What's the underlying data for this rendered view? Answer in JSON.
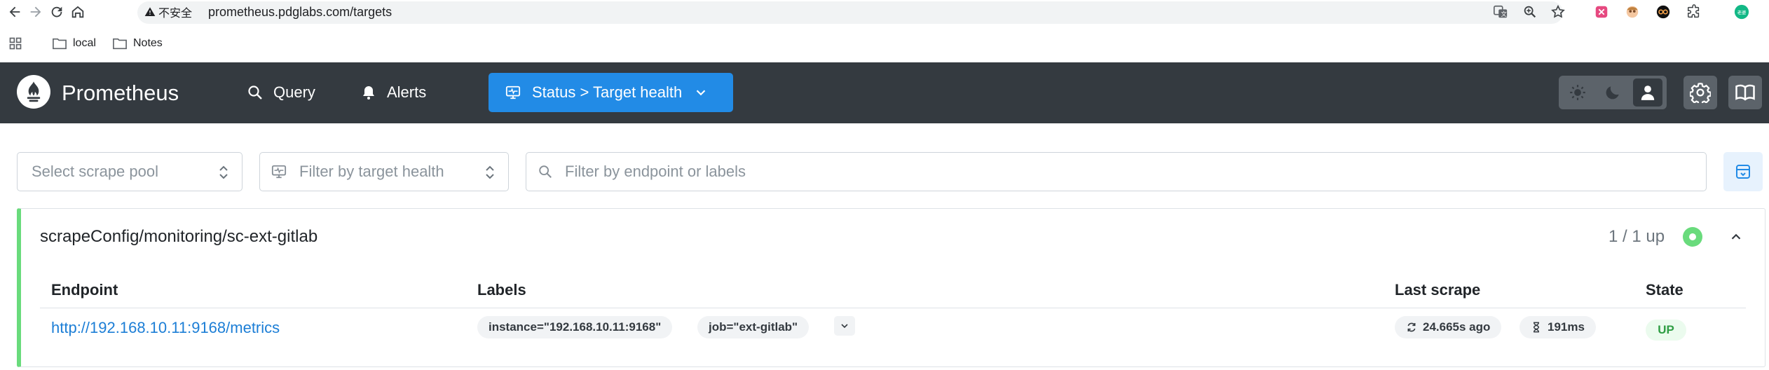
{
  "browser": {
    "security_label": "不安全",
    "url": "prometheus.pdglabs.com/targets",
    "bookmarks": [
      {
        "label": "local"
      },
      {
        "label": "Notes"
      }
    ],
    "profile_initials": "老婆"
  },
  "header": {
    "brand": "Prometheus",
    "nav": {
      "query": "Query",
      "alerts": "Alerts",
      "status": "Status > Target health"
    }
  },
  "filters": {
    "scrape_pool_placeholder": "Select scrape pool",
    "health_placeholder": "Filter by target health",
    "search_placeholder": "Filter by endpoint or labels"
  },
  "pool": {
    "name": "scrapeConfig/monitoring/sc-ext-gitlab",
    "count": "1 / 1 up",
    "status_color": "#69db7c",
    "columns": {
      "endpoint": "Endpoint",
      "labels": "Labels",
      "last_scrape": "Last scrape",
      "state": "State"
    },
    "targets": [
      {
        "endpoint": "http://192.168.10.11:9168/metrics",
        "labels": [
          "instance=\"192.168.10.11:9168\"",
          "job=\"ext-gitlab\""
        ],
        "last_scrape": "24.665s ago",
        "duration": "191ms",
        "state": "UP"
      }
    ]
  },
  "colors": {
    "header_bg": "#343a40",
    "accent": "#228be6",
    "up_green": "#2f9e44"
  }
}
